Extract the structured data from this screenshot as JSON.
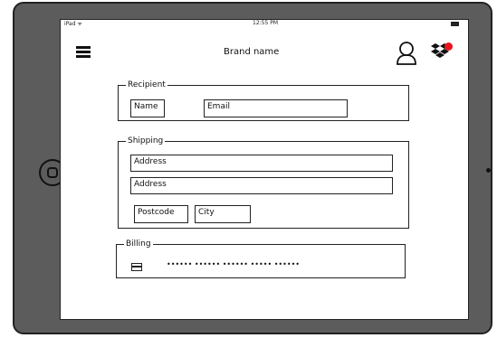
{
  "status": {
    "device": "iPad ᯤ",
    "time": "12:55 PM"
  },
  "header": {
    "brand": "Brand name",
    "menu_icon": "hamburger-icon",
    "user_icon": "user-icon",
    "cloud_icon": "dropbox-icon",
    "badge_color": "#e8141c"
  },
  "recipient": {
    "legend": "Recipient",
    "name_label": "Name",
    "email_label": "Email"
  },
  "shipping": {
    "legend": "Shipping",
    "address1": "Address",
    "address2": "Address",
    "postcode": "Postcode",
    "city": "City"
  },
  "billing": {
    "legend": "Billing",
    "card_icon": "credit-card-icon",
    "card_number": "•••••• •••••• •••••• ••••• ••••••"
  }
}
